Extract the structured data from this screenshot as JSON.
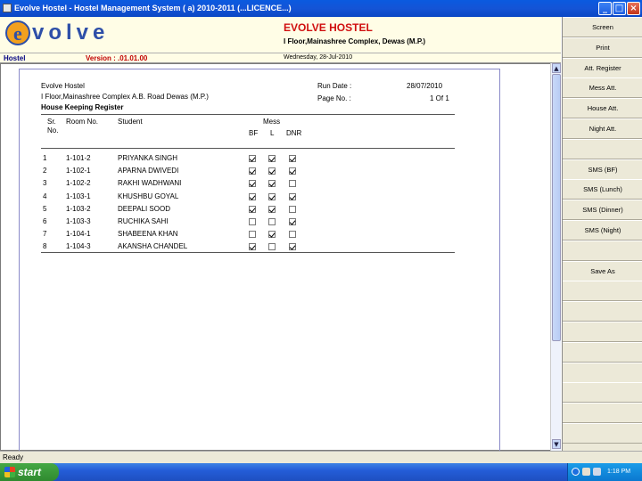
{
  "window": {
    "title": "Evolve Hostel - Hostel Management System ( a) 2010-2011 (...LICENCE...)",
    "min": "_",
    "max": "□",
    "close": "×"
  },
  "header": {
    "logo_mark": "e",
    "logo_text": "volve",
    "hostel_name": "EVOLVE HOSTEL",
    "hostel_address": "I Floor,Mainashree Complex, Dewas (M.P.)",
    "module": "Hostel",
    "version": "Version : .01.01.00",
    "date": "Wednesday, 28-Jul-2010"
  },
  "report": {
    "org": "Evolve Hostel",
    "address": "I Floor,Mainashree Complex A.B. Road Dewas (M.P.)",
    "title": "House Keeping Register",
    "run_date_label": "Run Date :",
    "run_date": "28/07/2010",
    "page_label": "Page No. :",
    "page": "1 Of 1",
    "columns": {
      "sr1": "Sr.",
      "sr2": "No.",
      "room": "Room No.",
      "student": "Student",
      "mess": "Mess",
      "bf": "BF",
      "l": "L",
      "dnr": "DNR"
    },
    "rows": [
      {
        "sr": "1",
        "room": "1-101-2",
        "student": "PRIYANKA SINGH",
        "bf": true,
        "l": true,
        "dnr": true
      },
      {
        "sr": "2",
        "room": "1-102-1",
        "student": "APARNA  DWIVEDI",
        "bf": true,
        "l": true,
        "dnr": true
      },
      {
        "sr": "3",
        "room": "1-102-2",
        "student": "RAKHI WADHWANI",
        "bf": true,
        "l": true,
        "dnr": false
      },
      {
        "sr": "4",
        "room": "1-103-1",
        "student": "KHUSHBU  GOYAL",
        "bf": true,
        "l": true,
        "dnr": true
      },
      {
        "sr": "5",
        "room": "1-103-2",
        "student": "DEEPALI  SOOD",
        "bf": true,
        "l": true,
        "dnr": false
      },
      {
        "sr": "6",
        "room": "1-103-3",
        "student": "RUCHIKA  SAHI",
        "bf": false,
        "l": false,
        "dnr": true
      },
      {
        "sr": "7",
        "room": "1-104-1",
        "student": "SHABEENA KHAN",
        "bf": false,
        "l": true,
        "dnr": false
      },
      {
        "sr": "8",
        "room": "1-104-3",
        "student": "AKANSHA CHANDEL",
        "bf": true,
        "l": false,
        "dnr": true
      }
    ]
  },
  "sidebar": {
    "buttons": [
      "Screen",
      "Print",
      "Att. Register",
      "Mess Att.",
      "House Att.",
      "Night Att.",
      "",
      "SMS (BF)",
      "SMS (Lunch)",
      "SMS (Dinner)",
      "SMS (Night)",
      "",
      "Save As",
      "",
      "",
      "",
      "",
      "",
      "",
      "",
      ""
    ]
  },
  "status": {
    "text": "Ready"
  },
  "taskbar": {
    "start": "start",
    "clock": "1:18 PM"
  },
  "scroll": {
    "up": "▲",
    "down": "▼"
  }
}
